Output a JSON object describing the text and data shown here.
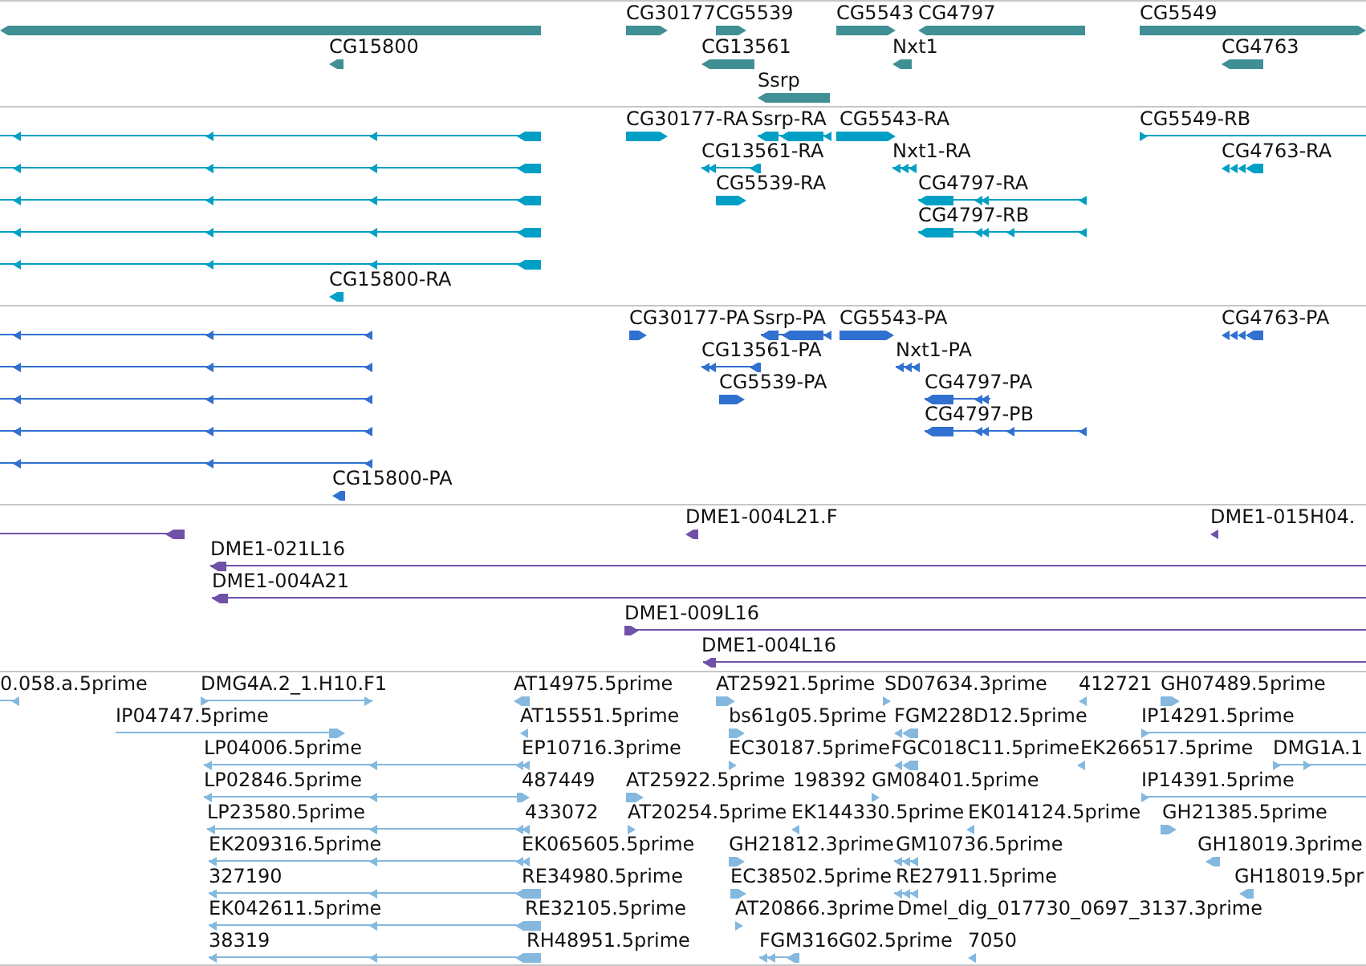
{
  "tracks": [
    {
      "color": "#408f95",
      "features": [
        {
          "reverse": true
        },
        {
          "label": "CG30177",
          "reverse": false
        },
        {
          "label": "CG5539",
          "reverse": false
        },
        {
          "label": "CG5543",
          "reverse": false
        },
        {
          "label": "CG4797",
          "reverse": true
        },
        {
          "label": "CG5549",
          "reverse": false
        },
        {
          "label": "CG15800",
          "reverse": true
        },
        {
          "label": "CG13561",
          "reverse": true
        },
        {
          "label": "Nxt1",
          "reverse": true
        },
        {
          "label": "CG4763",
          "reverse": true
        },
        {
          "label": "Ssrp",
          "reverse": true
        }
      ]
    },
    {
      "color": "#00a0c6",
      "features": [
        {
          "reverse": true
        },
        {
          "label": "CG30177-RA",
          "reverse": false
        },
        {
          "label": "Ssrp-RA",
          "reverse": true
        },
        {
          "label": "CG5543-RA",
          "reverse": false
        },
        {
          "label": "CG5549-RB",
          "reverse": false
        },
        {
          "reverse": true
        },
        {
          "label": "CG13561-RA",
          "reverse": true
        },
        {
          "label": "Nxt1-RA",
          "reverse": true
        },
        {
          "label": "CG4763-RA",
          "reverse": true
        },
        {
          "reverse": true
        },
        {
          "label": "CG5539-RA",
          "reverse": false
        },
        {
          "label": "CG4797-RA",
          "reverse": true
        },
        {
          "reverse": true
        },
        {
          "label": "CG4797-RB",
          "reverse": true
        },
        {
          "reverse": true
        },
        {
          "label": "CG15800-RA",
          "reverse": true
        }
      ]
    },
    {
      "color": "#3070d0",
      "features": [
        {
          "reverse": true
        },
        {
          "label": "CG30177-PA",
          "reverse": false
        },
        {
          "label": "Ssrp-PA",
          "reverse": true
        },
        {
          "label": "CG5543-PA",
          "reverse": false
        },
        {
          "label": "CG4763-PA",
          "reverse": true
        },
        {
          "reverse": true
        },
        {
          "label": "CG13561-PA",
          "reverse": true
        },
        {
          "label": "Nxt1-PA",
          "reverse": true
        },
        {
          "reverse": true
        },
        {
          "label": "CG5539-PA",
          "reverse": false
        },
        {
          "label": "CG4797-PA",
          "reverse": true
        },
        {
          "reverse": true
        },
        {
          "label": "CG4797-PB",
          "reverse": true
        },
        {
          "reverse": true
        },
        {
          "label": "CG15800-PA",
          "reverse": true
        }
      ]
    },
    {
      "color": "#7051a8",
      "features": [
        {
          "reverse": true
        },
        {
          "label": "DME1-004L21.F",
          "reverse": true
        },
        {
          "label": "DME1-015H04.",
          "reverse": true
        },
        {
          "label": "DME1-021L16",
          "reverse": true
        },
        {
          "label": "DME1-004A21",
          "reverse": true
        },
        {
          "label": "DME1-009L16",
          "reverse": false
        },
        {
          "label": "DME1-004L16",
          "reverse": true
        }
      ]
    },
    {
      "color": "#84b8de",
      "features": [
        {
          "label": "0.058.a.5prime",
          "reverse": true
        },
        {
          "label": "DMG4A.2_1.H10.F1",
          "reverse": false
        },
        {
          "label": "AT14975.5prime",
          "reverse": true
        },
        {
          "label": "AT25921.5prime",
          "reverse": false
        },
        {
          "label": "SD07634.3prime",
          "reverse": false
        },
        {
          "label": "412721",
          "reverse": true
        },
        {
          "label": "GH07489.5prime",
          "reverse": false
        },
        {
          "label": "IP04747.5prime",
          "reverse": false
        },
        {
          "label": "AT15551.5prime",
          "reverse": true
        },
        {
          "label": "bs61g05.5prime",
          "reverse": false
        },
        {
          "label": "FGM228D12.5prime",
          "reverse": true
        },
        {
          "label": "IP14291.5prime",
          "reverse": false
        },
        {
          "label": "LP04006.5prime",
          "reverse": true
        },
        {
          "label": "EP10716.3prime",
          "reverse": true
        },
        {
          "label": "EC30187.5prime",
          "reverse": false
        },
        {
          "label": "FGC018C11.5prime",
          "reverse": true
        },
        {
          "label": "EK266517.5prime",
          "reverse": true
        },
        {
          "label": "DMG1A.1",
          "reverse": false
        },
        {
          "label": "LP02846.5prime",
          "reverse": true
        },
        {
          "label": "487449",
          "reverse": false
        },
        {
          "label": "AT25922.5prime",
          "reverse": false
        },
        {
          "label": "198392"
        },
        {
          "label": "GM08401.5prime",
          "reverse": false
        },
        {
          "label": "IP14391.5prime",
          "reverse": false
        },
        {
          "label": "LP23580.5prime",
          "reverse": true
        },
        {
          "label": "433072",
          "reverse": true
        },
        {
          "label": "AT20254.5prime",
          "reverse": false
        },
        {
          "label": "EK144330.5prime",
          "reverse": true
        },
        {
          "label": "EK014124.5prime",
          "reverse": true
        },
        {
          "label": "GH21385.5prime",
          "reverse": false
        },
        {
          "label": "EK209316.5prime",
          "reverse": true
        },
        {
          "label": "EK065605.5prime",
          "reverse": true
        },
        {
          "label": "GH21812.3prime",
          "reverse": false
        },
        {
          "label": "GM10736.5prime",
          "reverse": true
        },
        {
          "label": "GH18019.3prime",
          "reverse": true
        },
        {
          "label": "327190",
          "reverse": true
        },
        {
          "label": "RE34980.5prime",
          "reverse": true
        },
        {
          "label": "EC38502.5prime",
          "reverse": false
        },
        {
          "label": "RE27911.5prime",
          "reverse": true
        },
        {
          "label": "GH18019.5pr",
          "reverse": true
        },
        {
          "label": "EK042611.5prime",
          "reverse": true
        },
        {
          "label": "RE32105.5prime",
          "reverse": true
        },
        {
          "label": "AT20866.3prime",
          "reverse": false
        },
        {
          "label": "Dmel_dig_017730_0697_3137.3prime"
        },
        {
          "label": "38319",
          "reverse": true
        },
        {
          "label": "RH48951.5prime",
          "reverse": true
        },
        {
          "label": "FGM316G02.5prime",
          "reverse": true
        },
        {
          "label": "7050",
          "reverse": true
        }
      ]
    }
  ]
}
